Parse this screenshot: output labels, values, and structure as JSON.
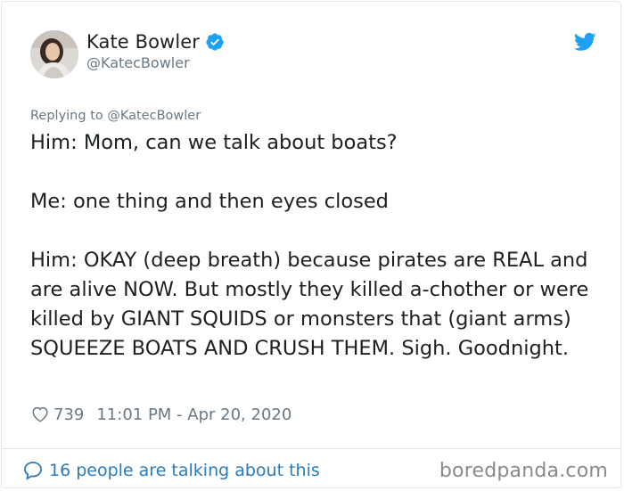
{
  "author": {
    "display_name": "Kate Bowler",
    "handle": "@KatecBowler",
    "verified": true
  },
  "replying_to": "Replying to @KatecBowler",
  "tweet": {
    "text": "Him: Mom, can we talk about boats?\n\nMe: one thing and then eyes closed\n\nHim: OKAY (deep breath) because pirates are REAL and are alive NOW. But mostly they killed a-chother or were killed by GIANT SQUIDS or monsters that (giant arms) SQUEEZE BOATS AND CRUSH THEM. Sigh. Goodnight.",
    "likes": "739",
    "timestamp": "11:01 PM - Apr 20, 2020"
  },
  "footer": {
    "talking_label": "16 people are talking about this"
  },
  "watermark": "boredpanda.com",
  "icons": {
    "verified": "verified-badge-icon",
    "brand": "twitter-bird-icon",
    "like": "heart-icon",
    "comment": "speech-bubble-icon"
  },
  "colors": {
    "twitter_blue": "#1da1f2",
    "link_blue": "#2b7bb9",
    "text_primary": "#1c2022",
    "text_secondary": "#697882",
    "border": "#e1e8ed"
  }
}
